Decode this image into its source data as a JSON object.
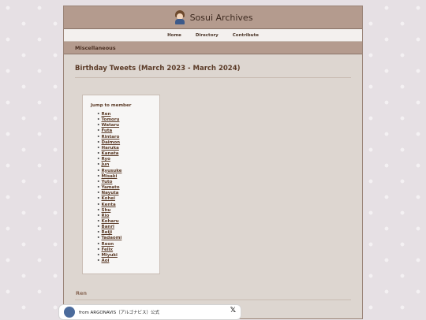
{
  "site": {
    "title": "Sosui Archives",
    "logo_icon": "character-avatar-icon"
  },
  "nav": [
    {
      "label": "Home"
    },
    {
      "label": "Directory"
    },
    {
      "label": "Contribute"
    }
  ],
  "breadcrumb": "Miscellaneous",
  "page_title": "Birthday Tweets (March 2023 - March 2024)",
  "toc": {
    "title": "Jump to member",
    "items": [
      "Ren",
      "Tomoru",
      "Wataru",
      "Futa",
      "Rintaro",
      "Daimon",
      "Haruka",
      "Kanata",
      "Ryo",
      "Jun",
      "Ryusuke",
      "Misaki",
      "Yuto",
      "Yamato",
      "Nayuta",
      "Kohei",
      "Kenta",
      "Shu",
      "Rio",
      "Koharu",
      "Banri",
      "Reiji",
      "Tadaomi",
      "Reon",
      "Felix",
      "Miyuki",
      "Aoi"
    ]
  },
  "section_heading": "Ren",
  "embed": {
    "from_text": "from ARGONAVIS（アルゴナビス）公式",
    "close_icon": "x-logo-icon"
  },
  "colors": {
    "header_bg": "#b49b8e",
    "page_bg": "#ddd6d0",
    "link": "#5a3a26"
  }
}
